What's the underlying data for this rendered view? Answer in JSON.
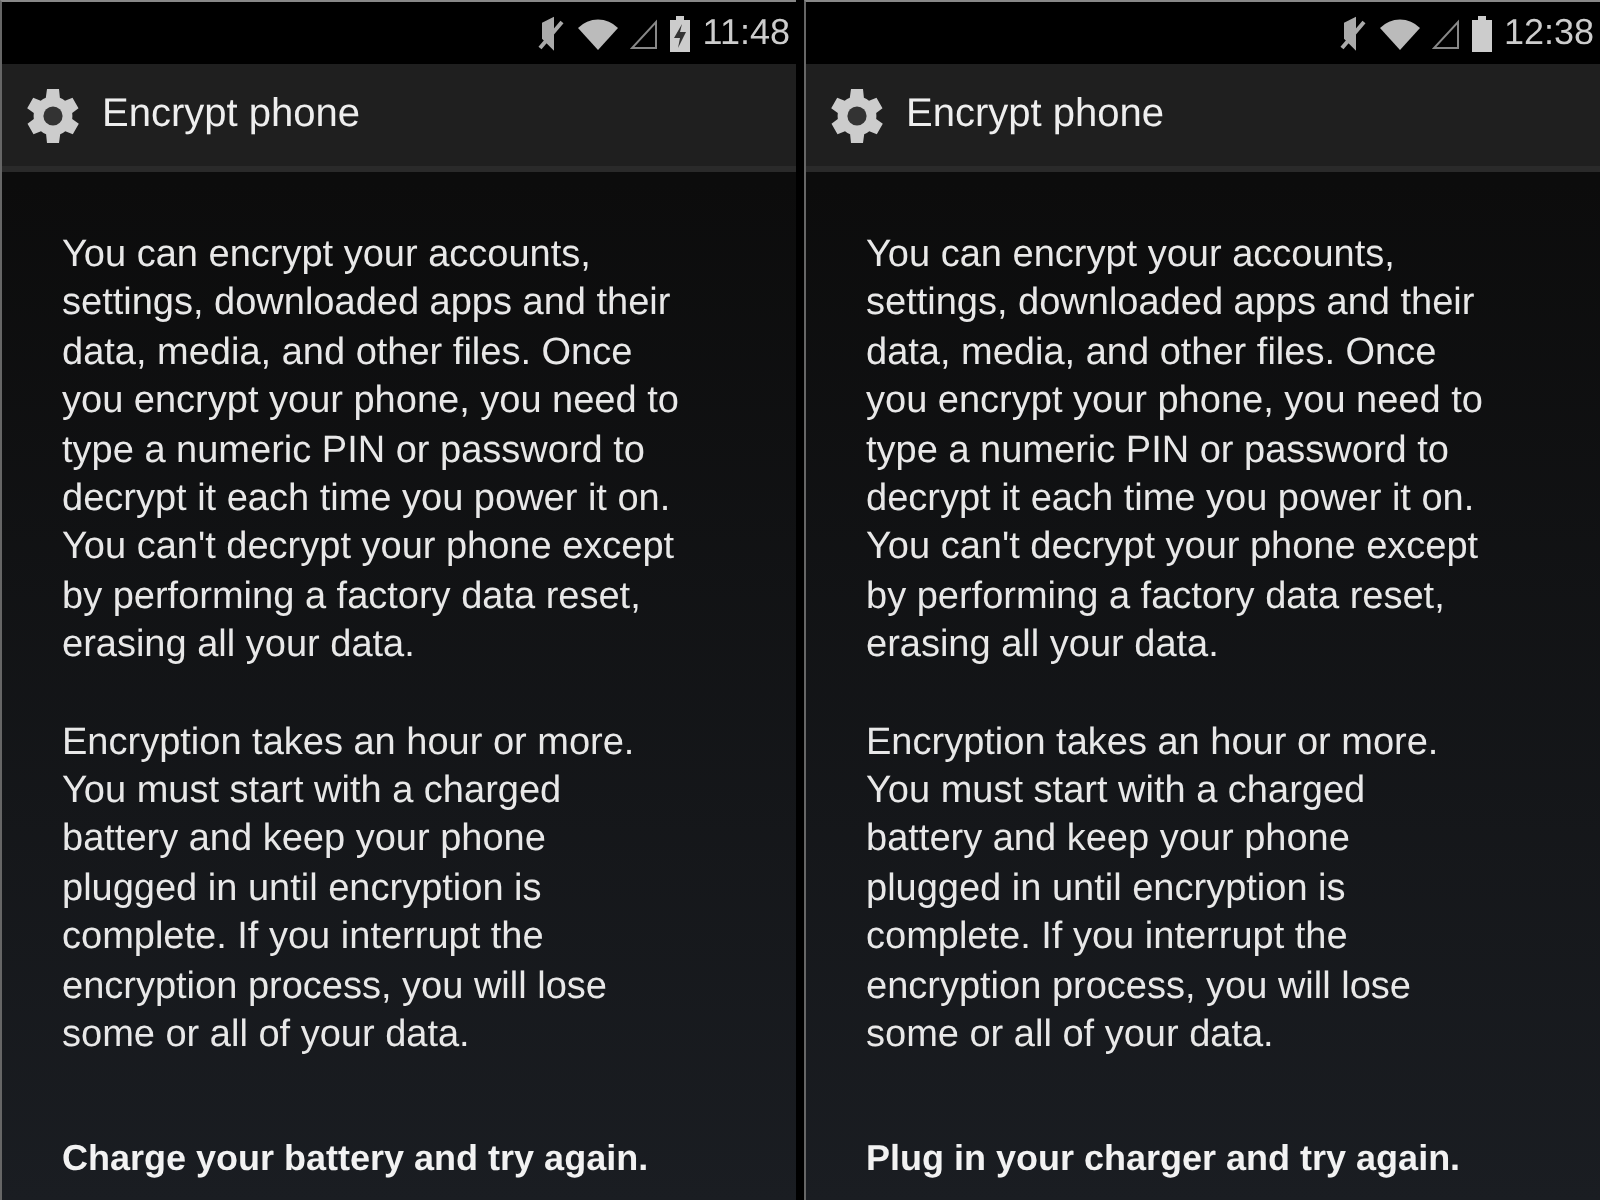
{
  "phones": [
    {
      "status_bar": {
        "time": "11:48",
        "charging": true
      },
      "title": "Encrypt phone",
      "paragraphs": [
        "You can encrypt your accounts,\nsettings, downloaded apps and their\ndata, media, and other files. Once\nyou encrypt your phone, you need to\ntype a numeric PIN or password to\ndecrypt it each time you power it on.\nYou can't decrypt your phone except\nby performing a factory data reset,\nerasing all your data.",
        "Encryption takes an hour or more.\nYou must start with a charged\nbattery and keep your phone\nplugged in until encryption is\ncomplete. If you interrupt the\nencryption process, you will lose\nsome or all of your data."
      ],
      "message": "Charge your battery and try again."
    },
    {
      "status_bar": {
        "time": "12:38",
        "charging": false
      },
      "title": "Encrypt phone",
      "paragraphs": [
        "You can encrypt your accounts,\nsettings, downloaded apps and their\ndata, media, and other files. Once\nyou encrypt your phone, you need to\ntype a numeric PIN or password to\ndecrypt it each time you power it on.\nYou can't decrypt your phone except\nby performing a factory data reset,\nerasing all your data.",
        "Encryption takes an hour or more.\nYou must start with a charged\nbattery and keep your phone\nplugged in until encryption is\ncomplete. If you interrupt the\nencryption process, you will lose\nsome or all of your data."
      ],
      "message": "Plug in your charger and try again."
    }
  ]
}
